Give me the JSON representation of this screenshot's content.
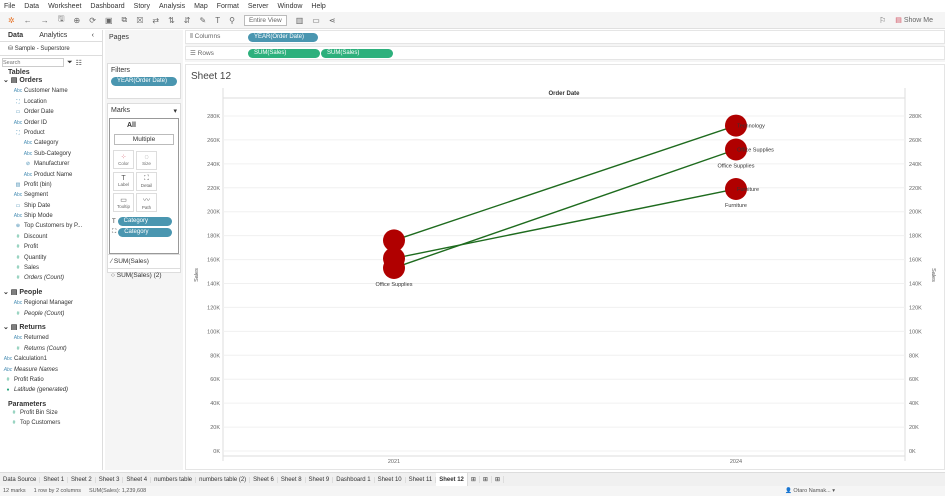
{
  "menu": [
    "File",
    "Data",
    "Worksheet",
    "Dashboard",
    "Story",
    "Analysis",
    "Map",
    "Format",
    "Server",
    "Window",
    "Help"
  ],
  "toolbar": {
    "fit": "Entire View",
    "show_me": "Show Me"
  },
  "datapane": {
    "tab_data": "Data",
    "tab_analytics": "Analytics",
    "source": "Sample - Superstore",
    "search_placeholder": "Search",
    "tables_label": "Tables",
    "groups": [
      {
        "name": "Orders",
        "fields": [
          {
            "icon": "Abc",
            "label": "Customer Name"
          },
          {
            "icon": "⛶",
            "label": "Location"
          },
          {
            "icon": "▭",
            "label": "Order Date"
          },
          {
            "icon": "Abc",
            "label": "Order ID"
          },
          {
            "icon": "⛶",
            "label": "Product"
          },
          {
            "icon": "Abc",
            "label": "Category",
            "sub": true
          },
          {
            "icon": "Abc",
            "label": "Sub-Category",
            "sub": true
          },
          {
            "icon": "⊘",
            "label": "Manufacturer",
            "sub": true
          },
          {
            "icon": "Abc",
            "label": "Product Name",
            "sub": true
          },
          {
            "icon": "▥",
            "label": "Profit (bin)"
          },
          {
            "icon": "Abc",
            "label": "Segment"
          },
          {
            "icon": "▭",
            "label": "Ship Date"
          },
          {
            "icon": "Abc",
            "label": "Ship Mode"
          },
          {
            "icon": "⊕",
            "label": "Top Customers by P..."
          },
          {
            "icon": "#",
            "label": "Discount",
            "m": true
          },
          {
            "icon": "#",
            "label": "Profit",
            "m": true
          },
          {
            "icon": "#",
            "label": "Quantity",
            "m": true
          },
          {
            "icon": "#",
            "label": "Sales",
            "m": true
          },
          {
            "icon": "#",
            "label": "Orders (Count)",
            "m": true,
            "i": true
          }
        ]
      },
      {
        "name": "People",
        "fields": [
          {
            "icon": "Abc",
            "label": "Regional Manager"
          },
          {
            "icon": "#",
            "label": "People (Count)",
            "m": true,
            "i": true
          }
        ]
      },
      {
        "name": "Returns",
        "fields": [
          {
            "icon": "Abc",
            "label": "Returned"
          },
          {
            "icon": "#",
            "label": "Returns (Count)",
            "m": true,
            "i": true
          }
        ]
      }
    ],
    "extra": [
      {
        "icon": "Abc",
        "label": "Calculation1"
      },
      {
        "icon": "Abc",
        "label": "Measure Names",
        "i": true
      },
      {
        "icon": "#",
        "label": "Profit Ratio",
        "m": true
      },
      {
        "icon": "●",
        "label": "Latitude (generated)",
        "m": true,
        "i": true
      }
    ],
    "parameters_label": "Parameters",
    "parameters": [
      "Profit Bin Size",
      "Top Customers"
    ]
  },
  "pages_label": "Pages",
  "filters_label": "Filters",
  "filter_pill": "YEAR(Order Date)",
  "marks": {
    "title": "Marks",
    "all": "All",
    "type": "Multiple",
    "buttons": [
      "Color",
      "Size",
      "Label",
      "Detail",
      "Tooltip",
      "Path"
    ],
    "pills": [
      "Category",
      "Category"
    ],
    "layers": [
      "SUM(Sales)",
      "SUM(Sales) (2)"
    ]
  },
  "shelves": {
    "columns_label": "Columns",
    "rows_label": "Rows",
    "columns": [
      "YEAR(Order Date)"
    ],
    "rows": [
      "SUM(Sales)",
      "SUM(Sales)"
    ]
  },
  "sheet_title": "Sheet 12",
  "chart_data": {
    "type": "line",
    "header": "Order Date",
    "x": [
      "2021",
      "2024"
    ],
    "ylabel": "Sales",
    "ylim": [
      0,
      280000
    ],
    "yticks": [
      "0K",
      "20K",
      "40K",
      "60K",
      "80K",
      "100K",
      "120K",
      "140K",
      "160K",
      "180K",
      "200K",
      "220K",
      "240K",
      "260K",
      "280K"
    ],
    "series": [
      {
        "name": "Technology",
        "values": [
          176000,
          272000
        ]
      },
      {
        "name": "Office Supplies",
        "values": [
          153000,
          252000
        ]
      },
      {
        "name": "Furniture",
        "values": [
          161000,
          219000
        ]
      }
    ],
    "line_color": "#1e6b1e",
    "dot_color": "#b00000",
    "labels_2021": [
      "Office Supplies"
    ],
    "labels_2024_right": [
      "Technology",
      "Office Supplies",
      "Furniture"
    ],
    "labels_2024_below": [
      "Office Supplies",
      "Furniture"
    ]
  },
  "sheet_tabs": [
    "Data Source",
    "Sheet 1",
    "Sheet 2",
    "Sheet 3",
    "Sheet 4",
    "numbers table",
    "numbers table (2)",
    "Sheet 6",
    "Sheet 8",
    "Sheet 9",
    "Dashboard 1",
    "Sheet 10",
    "Sheet 11",
    "Sheet 12"
  ],
  "status": {
    "marks": "12 marks",
    "rows": "1 row by 2 columns",
    "sum": "SUM(Sales): 1,239,608",
    "user": "Otaro Namak..."
  }
}
